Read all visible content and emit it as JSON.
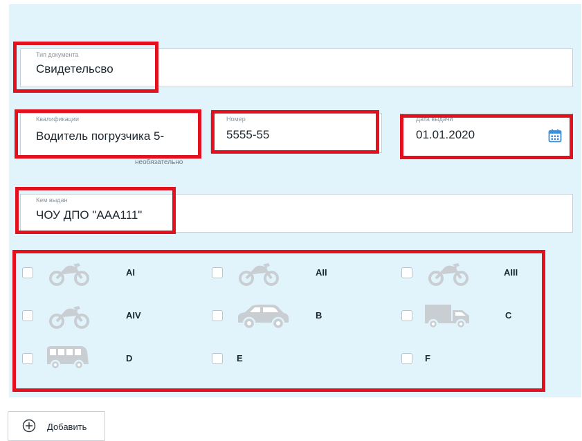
{
  "form": {
    "doc_type": {
      "label": "Тип документа",
      "value": "Свидетельсво"
    },
    "qualification": {
      "label": "Квалификации",
      "value": "Водитель погрузчика 5-",
      "hint": "необязательно"
    },
    "number": {
      "label": "Номер",
      "value": "5555-55"
    },
    "issue_date": {
      "label": "Дата выдачи",
      "value": "01.01.2020",
      "icon": "calendar-icon"
    },
    "issued_by": {
      "label": "Кем выдан",
      "value": "ЧОУ ДПО \"ААА111\""
    }
  },
  "categories": [
    {
      "code": "AI",
      "icon": "motorcycle-icon",
      "checked": false
    },
    {
      "code": "AII",
      "icon": "motorcycle-icon",
      "checked": false
    },
    {
      "code": "AIII",
      "icon": "motorcycle-icon",
      "checked": false
    },
    {
      "code": "AIV",
      "icon": "motorcycle-icon",
      "checked": false
    },
    {
      "code": "B",
      "icon": "car-icon",
      "checked": false
    },
    {
      "code": "C",
      "icon": "truck-icon",
      "checked": false
    },
    {
      "code": "D",
      "icon": "bus-icon",
      "checked": false
    },
    {
      "code": "E",
      "icon": "",
      "checked": false
    },
    {
      "code": "F",
      "icon": "",
      "checked": false
    }
  ],
  "actions": {
    "add_label": "Добавить",
    "add_icon": "plus-circle-icon"
  },
  "colors": {
    "panel_bg": "#e1f4fc",
    "highlight": "#e3101d",
    "icon_gray": "#c9ced2",
    "calendar_blue": "#3c8fd8"
  }
}
